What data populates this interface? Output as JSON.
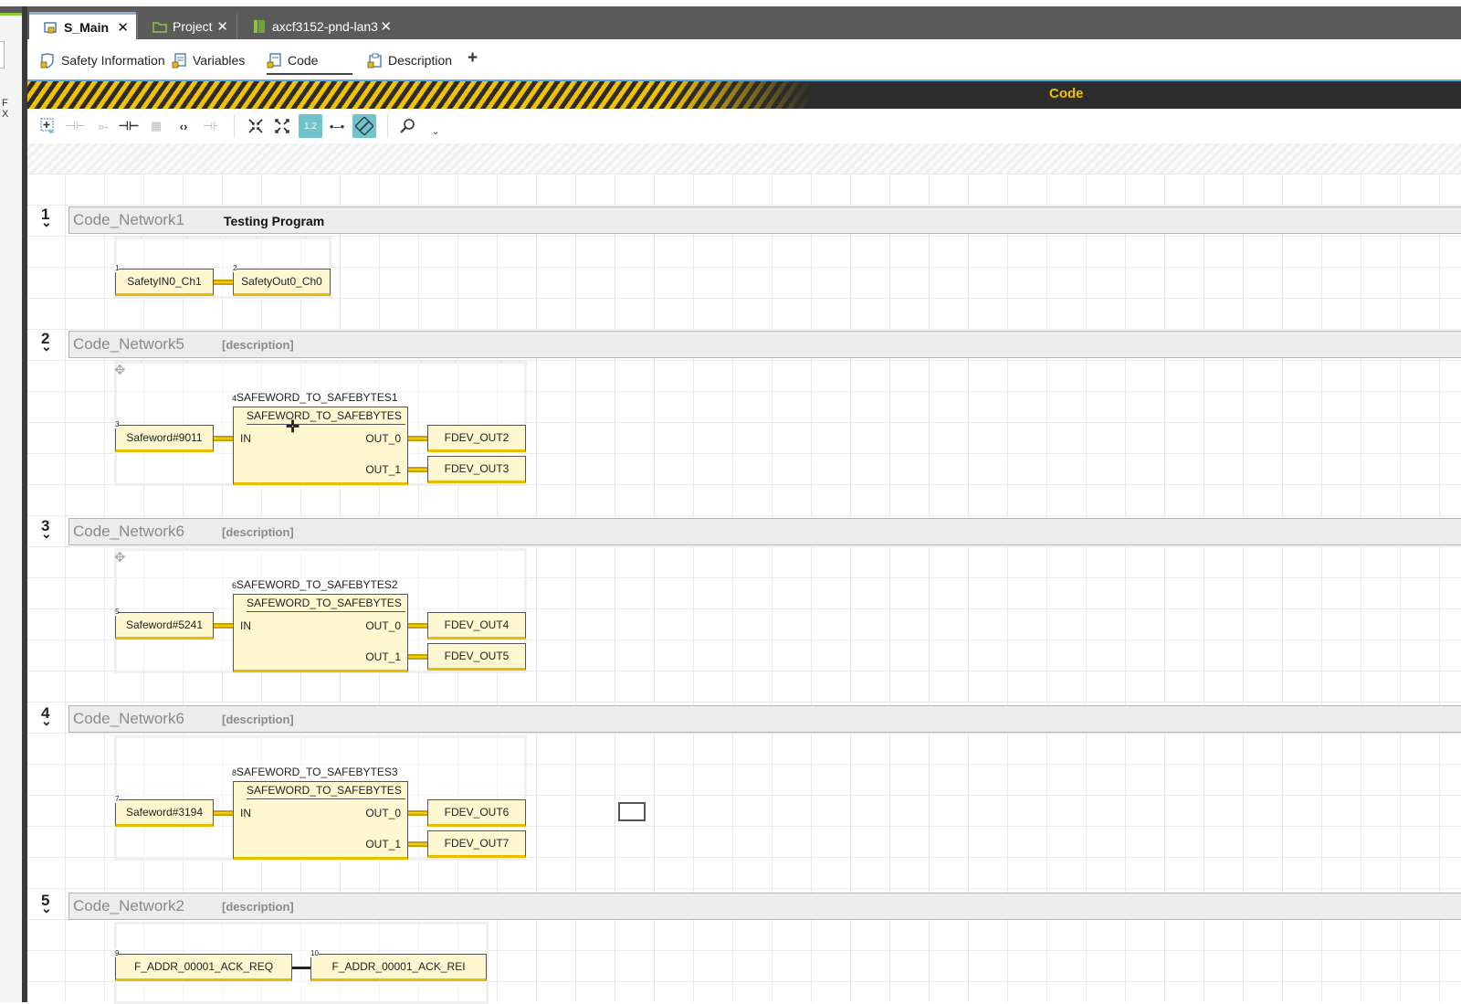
{
  "tabs": [
    {
      "label": "S_Main",
      "icon": "program-lock-icon",
      "active": true
    },
    {
      "label": "Project",
      "icon": "project-folder-icon",
      "active": false
    },
    {
      "label": "axcf3152-pnd-lan3",
      "icon": "device-icon",
      "active": false
    }
  ],
  "subtabs": [
    {
      "label": "Safety Information",
      "icon": "safety-info-icon"
    },
    {
      "label": "Variables",
      "icon": "variables-icon"
    },
    {
      "label": "Code",
      "icon": "code-icon",
      "active": true
    },
    {
      "label": "Description",
      "icon": "description-icon"
    }
  ],
  "subtab_add": "+",
  "left_panel": {
    "fx_label": "F X"
  },
  "editor": {
    "title": "Code"
  },
  "toolbar": [
    "insert-network-icon",
    "contact-icon",
    "coil-icon",
    "parallel-icon",
    "block-icon",
    "brackets-icon",
    "branch-icon",
    "collapse-icon",
    "expand-icon",
    "numbering-icon",
    "connect-icon",
    "autoroute-icon",
    "zoom-icon"
  ],
  "colors": {
    "accent": "#f2c200",
    "tab_bar": "#5b5b5b",
    "block_fill": "#fff7cf",
    "toolbar_active": "#6fc3c9"
  },
  "networks": [
    {
      "number": "1",
      "name": "Code_Network1",
      "description": "Testing Program",
      "vars": [
        {
          "num": "1",
          "label": "SafetyIN0_Ch1"
        },
        {
          "num": "2",
          "label": "SafetyOut0_Ch0"
        }
      ]
    },
    {
      "number": "2",
      "name": "Code_Network5",
      "description": "[description]",
      "instance_num": "4",
      "instance": "SAFEWORD_TO_SAFEBYTES1",
      "block_type": "SAFEWORD_TO_SAFEBYTES",
      "pin_in": "IN",
      "pin_out0": "OUT_0",
      "pin_out1": "OUT_1",
      "input": {
        "num": "3",
        "label": "Safeword#9011"
      },
      "outputs": [
        "FDEV_OUT2",
        "FDEV_OUT3"
      ]
    },
    {
      "number": "3",
      "name": "Code_Network6",
      "description": "[description]",
      "instance_num": "6",
      "instance": "SAFEWORD_TO_SAFEBYTES2",
      "block_type": "SAFEWORD_TO_SAFEBYTES",
      "pin_in": "IN",
      "pin_out0": "OUT_0",
      "pin_out1": "OUT_1",
      "input": {
        "num": "5",
        "label": "Safeword#5241"
      },
      "outputs": [
        "FDEV_OUT4",
        "FDEV_OUT5"
      ]
    },
    {
      "number": "4",
      "name": "Code_Network6",
      "description": "[description]",
      "instance_num": "8",
      "instance": "SAFEWORD_TO_SAFEBYTES3",
      "block_type": "SAFEWORD_TO_SAFEBYTES",
      "pin_in": "IN",
      "pin_out0": "OUT_0",
      "pin_out1": "OUT_1",
      "input": {
        "num": "7",
        "label": "Safeword#3194"
      },
      "outputs": [
        "FDEV_OUT6",
        "FDEV_OUT7"
      ]
    },
    {
      "number": "5",
      "name": "Code_Network2",
      "description": "[description]",
      "vars": [
        {
          "num": "9",
          "label": "F_ADDR_00001_ACK_REQ"
        },
        {
          "num": "10",
          "label": "F_ADDR_00001_ACK_REI"
        }
      ]
    }
  ]
}
